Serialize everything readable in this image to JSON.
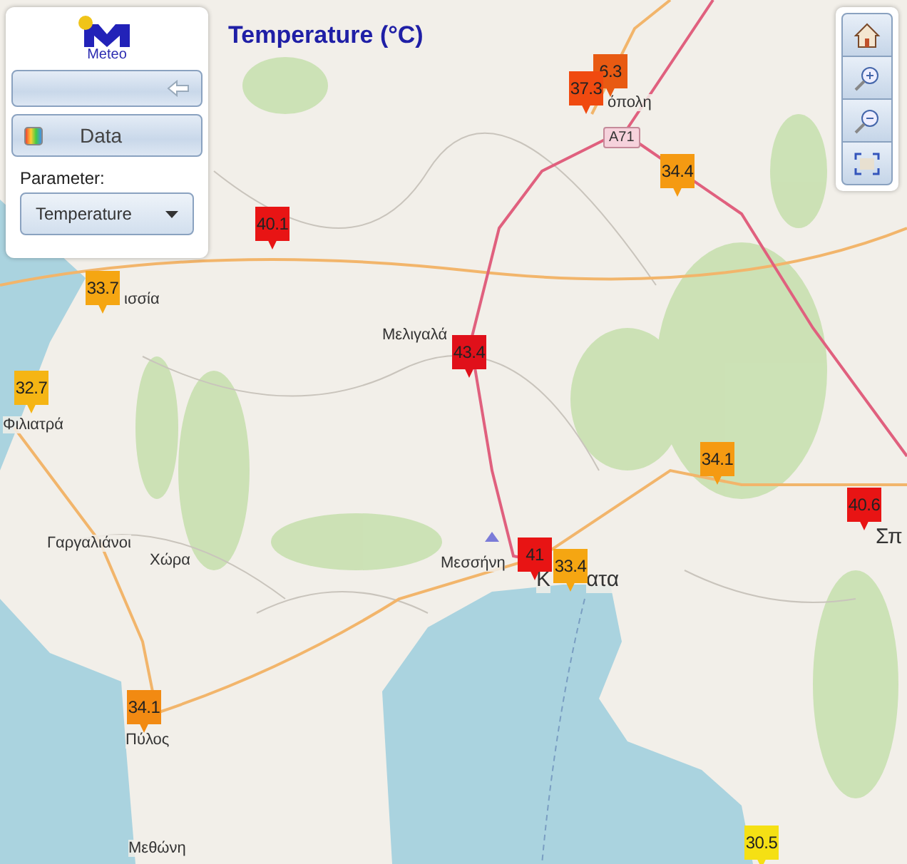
{
  "logo": {
    "text": "Meteo"
  },
  "panel": {
    "data_button": "Data",
    "parameter_label": "Parameter:",
    "parameter_select": "Temperature"
  },
  "title": "Temperature (°C)",
  "map": {
    "road_shield": "A71",
    "place_labels": [
      {
        "text": "όπολη"
      },
      {
        "text": "ισσία"
      },
      {
        "text": "Μελιγαλά"
      },
      {
        "text": "Φιλιατρά"
      },
      {
        "text": "Γαργαλιάνοι"
      },
      {
        "text": "Χώρα"
      },
      {
        "text": "Μεσσήνη"
      },
      {
        "text": "Κ"
      },
      {
        "text": "ατα"
      },
      {
        "text": "Σπ"
      },
      {
        "text": "Πύλος"
      },
      {
        "text": "Μεθώνη"
      }
    ],
    "markers": [
      {
        "value": "6.3",
        "color": "#e85a12"
      },
      {
        "value": "37.3",
        "color": "#f04a10"
      },
      {
        "value": "34.4",
        "color": "#f59a12"
      },
      {
        "value": "40.1",
        "color": "#e81414"
      },
      {
        "value": "33.7",
        "color": "#f5a612"
      },
      {
        "value": "32.7",
        "color": "#f5b514"
      },
      {
        "value": "43.4",
        "color": "#e0101a"
      },
      {
        "value": "34.1",
        "color": "#f59a12"
      },
      {
        "value": "40.6",
        "color": "#e81414"
      },
      {
        "value": "41",
        "color": "#e81414"
      },
      {
        "value": "33.4",
        "color": "#f5a612"
      },
      {
        "value": "34.1",
        "color": "#f28a12"
      },
      {
        "value": "30.5",
        "color": "#f5e014"
      }
    ]
  }
}
